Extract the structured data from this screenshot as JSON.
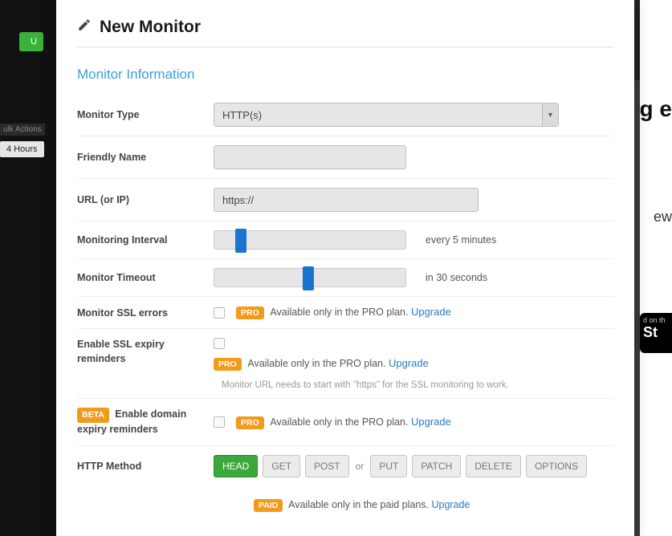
{
  "bg": {
    "green_btn": "U",
    "bulk": "ulk Actions",
    "hours": "4 Hours",
    "right1": "g e",
    "right2": "ew",
    "store_top": "d on th",
    "store_bottom": "St"
  },
  "modal": {
    "title": "New Monitor",
    "section": "Monitor Information"
  },
  "fields": {
    "monitor_type_label": "Monitor Type",
    "monitor_type_value": "HTTP(s)",
    "friendly_name_label": "Friendly Name",
    "friendly_name_value": "",
    "url_label": "URL (or IP)",
    "url_value": "https://",
    "interval_label": "Monitoring Interval",
    "interval_caption": "every 5 minutes",
    "timeout_label": "Monitor Timeout",
    "timeout_caption": "in 30 seconds",
    "ssl_errors_label": "Monitor SSL errors",
    "ssl_expiry_label": "Enable SSL expiry reminders",
    "domain_expiry_label": "Enable domain expiry reminders",
    "http_method_label": "HTTP Method"
  },
  "badges": {
    "pro": "PRO",
    "beta": "BETA",
    "paid": "PAID"
  },
  "pro_text": "Available only in the PRO plan. ",
  "paid_text": "Available only in the paid plans. ",
  "upgrade": "Upgrade",
  "ssl_note": "Monitor URL needs to start with \"https\" for the SSL monitoring to work.",
  "http_methods": {
    "head": "HEAD",
    "get": "GET",
    "post": "POST",
    "or": "or",
    "put": "PUT",
    "patch": "PATCH",
    "delete": "DELETE",
    "options": "OPTIONS"
  }
}
